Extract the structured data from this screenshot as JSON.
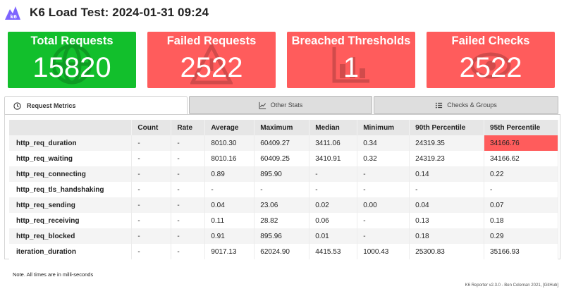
{
  "header": {
    "title": "K6 Load Test: 2024-01-31 09:24",
    "logo_icon": "k6-logo-icon",
    "logo_color": "#7d64ff"
  },
  "cards": [
    {
      "label": "Total Requests",
      "value": "15820",
      "color": "#12bf2c",
      "icon": "globe-icon"
    },
    {
      "label": "Failed Requests",
      "value": "2522",
      "color": "#ff5c5c",
      "icon": "warning-icon"
    },
    {
      "label": "Breached Thresholds",
      "value": "1",
      "color": "#ff5c5c",
      "icon": "chart-icon"
    },
    {
      "label": "Failed Checks",
      "value": "2522",
      "color": "#ff5c5c",
      "icon": "eye-icon"
    }
  ],
  "tabs": [
    {
      "label": "Request Metrics",
      "icon": "clock-icon",
      "active": true
    },
    {
      "label": "Other Stats",
      "icon": "chart-line-icon",
      "active": false
    },
    {
      "label": "Checks & Groups",
      "icon": "list-check-icon",
      "active": false
    }
  ],
  "table": {
    "columns": [
      "",
      "Count",
      "Rate",
      "Average",
      "Maximum",
      "Median",
      "Minimum",
      "90th Percentile",
      "95th Percentile"
    ],
    "rows": [
      {
        "metric": "http_req_duration",
        "cells": [
          "-",
          "-",
          "8010.30",
          "60409.27",
          "3411.06",
          "0.34",
          "24319.35",
          "34166.76"
        ],
        "breach_col": 7
      },
      {
        "metric": "http_req_waiting",
        "cells": [
          "-",
          "-",
          "8010.16",
          "60409.25",
          "3410.91",
          "0.32",
          "24319.23",
          "34166.62"
        ]
      },
      {
        "metric": "http_req_connecting",
        "cells": [
          "-",
          "-",
          "0.89",
          "895.90",
          "-",
          "-",
          "0.14",
          "0.22"
        ]
      },
      {
        "metric": "http_req_tls_handshaking",
        "cells": [
          "-",
          "-",
          "-",
          "-",
          "-",
          "-",
          "-",
          "-"
        ]
      },
      {
        "metric": "http_req_sending",
        "cells": [
          "-",
          "-",
          "0.04",
          "23.06",
          "0.02",
          "0.00",
          "0.04",
          "0.07"
        ]
      },
      {
        "metric": "http_req_receiving",
        "cells": [
          "-",
          "-",
          "0.11",
          "28.82",
          "0.06",
          "-",
          "0.13",
          "0.18"
        ]
      },
      {
        "metric": "http_req_blocked",
        "cells": [
          "-",
          "-",
          "0.91",
          "895.96",
          "0.01",
          "-",
          "0.18",
          "0.29"
        ]
      },
      {
        "metric": "iteration_duration",
        "cells": [
          "-",
          "-",
          "9017.13",
          "62024.90",
          "4415.53",
          "1000.43",
          "25300.83",
          "35166.93"
        ]
      }
    ],
    "breach_color": "#ff5c5c"
  },
  "note": "Note. All times are in milli-seconds",
  "footer": "K6 Reporter v2.3.0 - Ben Coleman 2021, [GitHub]"
}
